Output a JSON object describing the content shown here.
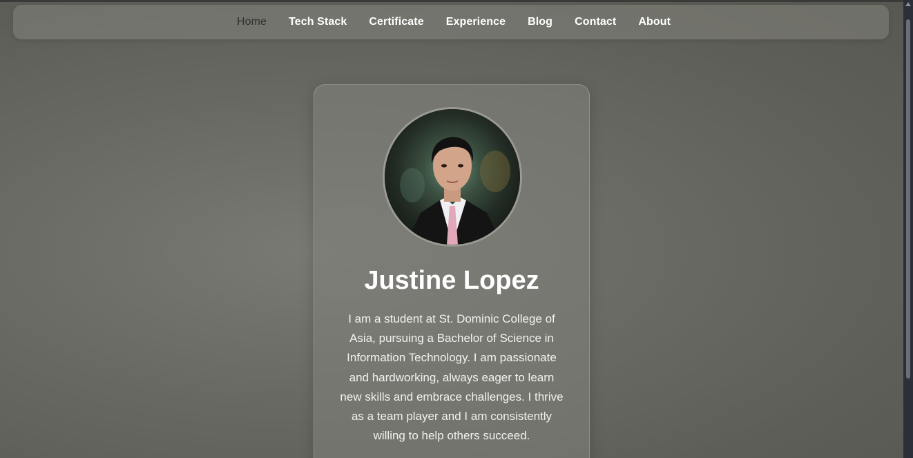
{
  "nav": {
    "items": [
      {
        "label": "Home",
        "active": true
      },
      {
        "label": "Tech Stack",
        "active": false
      },
      {
        "label": "Certificate",
        "active": false
      },
      {
        "label": "Experience",
        "active": false
      },
      {
        "label": "Blog",
        "active": false
      },
      {
        "label": "Contact",
        "active": false
      },
      {
        "label": "About",
        "active": false
      }
    ]
  },
  "profile": {
    "name": "Justine Lopez",
    "bio": "I am a student at St. Dominic College of Asia, pursuing a Bachelor of Science in Information Technology. I am passionate and hardworking, always eager to learn new skills and embrace challenges. I thrive as a team player and I am consistently willing to help others succeed."
  },
  "colors": {
    "background": "#6a6a64",
    "nav_text": "#ffffff",
    "nav_active_text": "#2e2e2c",
    "card_border": "#9a9a92",
    "scrollbar": "#2b2f38"
  }
}
